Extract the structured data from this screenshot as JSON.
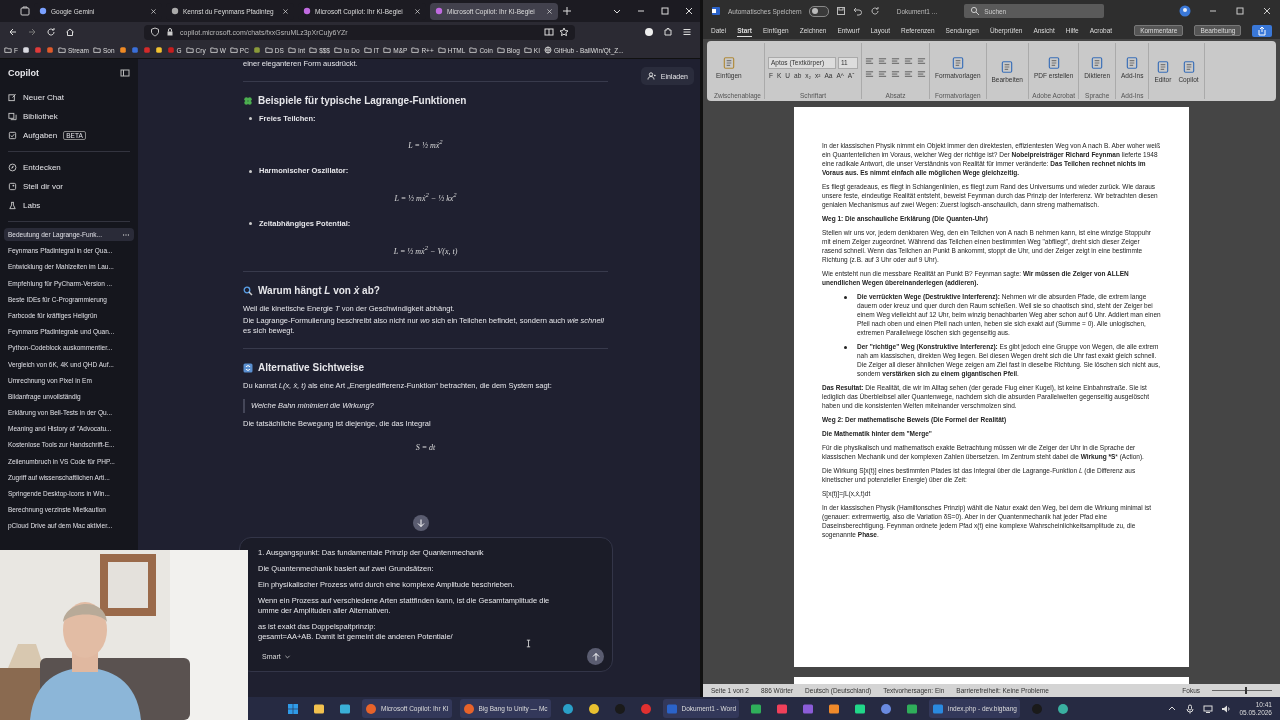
{
  "browser": {
    "tabs": [
      {
        "label": "Google Gemini",
        "selected": false
      },
      {
        "label": "Kennst du Feynmans Pfadinteg",
        "selected": false
      },
      {
        "label": "Microsoft Copilot: Ihr KI-Beglei",
        "selected": false
      },
      {
        "label": "Microsoft Copilot: Ihr KI-Beglei",
        "selected": true
      }
    ],
    "url": "copilot.microsoft.com/chats/fxxGsruMLz3pXrCujy6YZr",
    "bookmarks": [
      {
        "kind": "folder",
        "label": "F"
      },
      {
        "kind": "site",
        "color": "#d9d9e0"
      },
      {
        "kind": "site",
        "color": "#e03a3a"
      },
      {
        "kind": "site",
        "color": "#e05a2a"
      },
      {
        "kind": "folder",
        "label": "Stream"
      },
      {
        "kind": "folder",
        "label": "Son"
      },
      {
        "kind": "site",
        "color": "#f08a24"
      },
      {
        "kind": "site",
        "color": "#3a6fd8"
      },
      {
        "kind": "site",
        "color": "#d42a2a"
      },
      {
        "kind": "site",
        "color": "#f2c230"
      },
      {
        "kind": "site",
        "color": "#c81e1e",
        "label": "G"
      },
      {
        "kind": "folder",
        "label": "Cry"
      },
      {
        "kind": "folder",
        "label": "W"
      },
      {
        "kind": "folder",
        "label": "PC"
      },
      {
        "kind": "site",
        "color": "#8a9a3a"
      },
      {
        "kind": "folder",
        "label": "DS"
      },
      {
        "kind": "folder",
        "label": "Int"
      },
      {
        "kind": "folder",
        "label": "$$$"
      },
      {
        "kind": "folder",
        "label": "to Do"
      },
      {
        "kind": "folder",
        "label": "IT"
      },
      {
        "kind": "folder",
        "label": "M&P"
      },
      {
        "kind": "folder",
        "label": "R++"
      },
      {
        "kind": "folder",
        "label": "HTML"
      },
      {
        "kind": "folder",
        "label": "Coin"
      },
      {
        "kind": "folder",
        "label": "Blog"
      },
      {
        "kind": "folder",
        "label": "KI"
      },
      {
        "kind": "globe",
        "label": "GitHub - BallWin/Qt_Z..."
      }
    ]
  },
  "copilot": {
    "title": "Copilot",
    "nav": [
      {
        "kind": "new",
        "label": "Neuer Chat"
      },
      {
        "kind": "library",
        "label": "Bibliothek"
      },
      {
        "kind": "tasks",
        "label": "Aufgaben",
        "badge": "BETA"
      },
      {
        "kind": "discover",
        "label": "Entdecken"
      },
      {
        "kind": "imagine",
        "label": "Stell dir vor"
      },
      {
        "kind": "labs",
        "label": "Labs"
      }
    ],
    "conversations": [
      {
        "label": "Bedeutung der Lagrange-Funk...",
        "selected": true
      },
      {
        "label": "Feynmans Pfadintegral in der Qua...",
        "selected": false
      },
      {
        "label": "Entwicklung der Mahlzeiten im Lau...",
        "selected": false
      },
      {
        "label": "Empfehlung für PyCharm-Version ...",
        "selected": false
      },
      {
        "label": "Beste IDEs für C-Programmierung",
        "selected": false
      },
      {
        "label": "Farbcode für kräftiges Hellgrün",
        "selected": false
      },
      {
        "label": "Feynmans Pfadintegrale und Quan...",
        "selected": false
      },
      {
        "label": "Python-Codeblock auskommentier...",
        "selected": false
      },
      {
        "label": "Vergleich von 6K, 4K und QHD Auf...",
        "selected": false
      },
      {
        "label": "Umrechnung von Pixel in Em",
        "selected": false
      },
      {
        "label": "Bildanfrage unvollständig",
        "selected": false
      },
      {
        "label": "Erklärung von Bell-Tests in der Qu...",
        "selected": false
      },
      {
        "label": "Meaning and History of \"Advocatu...",
        "selected": false
      },
      {
        "label": "Kostenlose Tools zur Handschrift-E...",
        "selected": false
      },
      {
        "label": "Zeilenumbruch in VS Code für PHP...",
        "selected": false
      },
      {
        "label": "Zugriff auf wissenschaftlichen Arti...",
        "selected": false
      },
      {
        "label": "Springende Desktop-Icons in Win...",
        "selected": false
      },
      {
        "label": "Berechnung verzinste Mietkaution",
        "selected": false
      },
      {
        "label": "pCloud Drive auf dem Mac aktivier...",
        "selected": false
      }
    ],
    "invite": "Einladen",
    "messages": [
      {
        "kind": "para",
        "text": "einer eleganteren Form ausdrückt."
      },
      {
        "kind": "rule"
      },
      {
        "kind": "heading",
        "text": "Beispiele für typische Lagrange-Funktionen"
      },
      {
        "kind": "bullet",
        "text": "Freies Teilchen:"
      },
      {
        "kind": "formula",
        "text": "L = ½ mẋ$^{2}$"
      },
      {
        "kind": "bullet",
        "text": "Harmonischer Oszillator:"
      },
      {
        "kind": "formula",
        "text": "L = ½ mẋ$^{2}$ − ½ kx$^{2}$"
      },
      {
        "kind": "bullet",
        "text": "Zeitabhängiges Potential:"
      },
      {
        "kind": "formula",
        "text": "L = ½ mẋ$^{2}$ − V(x, t)"
      },
      {
        "kind": "rule"
      },
      {
        "kind": "heading",
        "text": "Warum hängt *L* von *ẋ* ab?"
      },
      {
        "kind": "para",
        "text": "Weil die kinetische Energie *T* von der Geschwindigkeit abhängt."
      },
      {
        "kind": "para",
        "text": "Die Lagrange-Formulierung beschreibt also nicht nur *wo* sich ein Teilchen befindet, sondern auch *wie schnell* es sich bewegt."
      },
      {
        "kind": "rule"
      },
      {
        "kind": "heading",
        "text": "Alternative Sichtweise"
      },
      {
        "kind": "para",
        "text": "Du kannst *L(x, ẋ, t)* als eine Art „Energiedifferenz-Funktion“ betrachten, die dem System sagt:"
      },
      {
        "kind": "quote",
        "text": "Welche Bahn minimiert die Wirkung?"
      },
      {
        "kind": "para",
        "text": "Die tatsächliche Bewegung ist diejenige, die das Integral"
      },
      {
        "kind": "formula",
        "text": "S =       dt"
      }
    ],
    "composer": {
      "paragraphs": [
        [
          "1. Ausgangspunkt: Das fundamentale Prinzip der Quantenmechanik"
        ],
        [
          "Die Quantenmechanik basiert auf zwei Grundsätzen:"
        ],
        [
          "Ein physikalischer Prozess wird durch eine komplexe Amplitude beschrieben."
        ],
        [
          "Wenn ein Prozess auf verschiedene Arten stattfinden kann, ist die Gesamtamplitude die",
          "umme der Amplituden aller Alternativen."
        ],
        [
          "as ist exakt das Doppelspaltprinzip:",
          "gesamt=AA+AB. Damit ist gemeint die anderen Potentiale/"
        ]
      ],
      "mode": "Smart"
    }
  },
  "word": {
    "autosave_label": "Automatisches Speichern",
    "autosave_on": false,
    "doc_title": "Dokument1 ...",
    "search": {
      "placeholder": "Suchen"
    },
    "menu": [
      {
        "label": "Datei",
        "selected": false
      },
      {
        "label": "Start",
        "selected": true
      },
      {
        "label": "Einfügen",
        "selected": false
      },
      {
        "label": "Zeichnen",
        "selected": false
      },
      {
        "label": "Entwurf",
        "selected": false
      },
      {
        "label": "Layout",
        "selected": false
      },
      {
        "label": "Referenzen",
        "selected": false
      },
      {
        "label": "Sendungen",
        "selected": false
      },
      {
        "label": "Überprüfen",
        "selected": false
      },
      {
        "label": "Ansicht",
        "selected": false
      },
      {
        "label": "Hilfe",
        "selected": false
      },
      {
        "label": "Acrobat",
        "selected": false
      }
    ],
    "comments": "Kommentare",
    "editing": "Bearbeitung",
    "ribbon": [
      {
        "kind": "clipboard",
        "label": "Zwischenablage",
        "buttons": [
          "Einfügen"
        ]
      },
      {
        "kind": "font",
        "label": "Schriftart",
        "font": "Aptos (Textkörper)",
        "size": "11",
        "tools": [
          "F",
          "K",
          "U",
          "ab",
          "x₂",
          "x²",
          "Aa",
          "A^",
          "Aˇ"
        ]
      },
      {
        "kind": "paragraph",
        "label": "Absatz"
      },
      {
        "kind": "buttons",
        "label": "Formatvorlagen",
        "buttons": [
          "Formatvorlagen"
        ]
      },
      {
        "kind": "buttons",
        "buttons": [
          "Bearbeiten"
        ]
      },
      {
        "kind": "buttons",
        "label": "Adobe Acrobat",
        "buttons": [
          "PDF erstellen"
        ]
      },
      {
        "kind": "buttons",
        "label": "Sprache",
        "buttons": [
          "Diktieren"
        ]
      },
      {
        "kind": "buttons",
        "label": "Add-Ins",
        "buttons": [
          "Add-Ins"
        ]
      },
      {
        "kind": "buttons",
        "buttons": [
          "Editor",
          "Copilot"
        ]
      }
    ],
    "document": [
      {
        "kind": "para",
        "text": "In der klassischen Physik nimmt ein Objekt immer den direktesten, effizientesten Weg von A nach B. Aber woher weiß ein Quantenteilchen im Voraus, welcher Weg der richtige ist? Der **Nobelpreisträger Richard Feynman** lieferte 1948 eine radikale Antwort, die unser Verständnis von Realität für immer veränderte: **Das Teilchen rechnet nichts im Voraus aus. Es nimmt einfach alle möglichen Wege gleichzeitig.**"
      },
      {
        "kind": "para",
        "text": "Es fliegt geradeaus, es fliegt in Schlangenlinien, es fliegt zum Rand des Universums und wieder zurück. Wie daraus unsere feste, eindeutige Realität entsteht, beweist Feynman durch das Prinzip der Interferenz. Wir betrachten diesen genialen Mechanismus auf zwei Wegen: Zuerst logisch-anschaulich, dann streng mathematisch."
      },
      {
        "kind": "heading",
        "text": "Weg 1: Die anschauliche Erklärung (Die Quanten-Uhr)"
      },
      {
        "kind": "para",
        "text": "Stellen wir uns vor, jedem denkbaren Weg, den ein Teilchen von A nach B nehmen kann, ist eine winzige Stoppuhr mit einem Zeiger zugeordnet. Während das Teilchen einen bestimmten Weg \"abfliegt\", dreht sich dieser Zeiger rasend schnell. Wenn das Teilchen an Punkt B ankommt, stoppt die Uhr, und der Zeiger zeigt in eine bestimmte Richtung (z.B. auf 3 Uhr oder auf 9 Uhr)."
      },
      {
        "kind": "para",
        "text": "Wie entsteht nun die messbare Realität an Punkt B? Feynman sagte: **Wir müssen die Zeiger von ALLEN unendlichen Wegen übereinanderlegen (addieren).**"
      },
      {
        "kind": "bullet",
        "text": "**Die verrückten Wege (Destruktive Interferenz):** Nehmen wir die absurden Pfade, die extrem lange dauern oder kreuz und quer durch den Raum schießen. Weil sie so chaotisch sind, steht der Zeiger bei einem Weg vielleicht auf 12 Uhr, beim winzig benachbarten Weg aber schon auf 6 Uhr. Addiert man einen Pfeil nach oben und einen Pfeil nach unten, heben sie sich exakt auf (Summe = 0). Alle unlogischen, extremen Parallelwege löschen sich gegenseitig aus."
      },
      {
        "kind": "bullet",
        "text": "**Der \"richtige\" Weg (Konstruktive Interferenz):** Es gibt jedoch eine Gruppe von Wegen, die alle extrem nah am klassischen, direkten Weg liegen. Bei diesen Wegen dreht sich die Uhr fast exakt gleich schnell. Die Zeiger all dieser ähnlichen Wege zeigen am Ziel fast in dieselbe Richtung. Sie löschen sich nicht aus, sondern **verstärken sich zu einem gigantischen Pfeil**."
      },
      {
        "kind": "para",
        "text": "**Das Resultat:** Die Realität, die wir im Alltag sehen (der gerade Flug einer Kugel), ist keine Einbahnstraße. Sie ist lediglich das Überbleibsel aller Quantenwege, nachdem sich die absurden Parallelwelten gegenseitig ausgelöscht haben und die konsistenten Welten miteinander verschmolzen sind."
      },
      {
        "kind": "heading",
        "text": "Weg 2: Der mathematische Beweis (Die Formel der Realität)"
      },
      {
        "kind": "heading",
        "text": "Die Mathematik hinter dem \"Merge\""
      },
      {
        "kind": "para",
        "text": "Für die physikalisch und mathematisch exakte Betrachtung müssen wir die Zeiger der Uhr in die Sprache der klassischen Mechanik und der komplexen Zahlen übersetzen. Im Zentrum steht dabei die **Wirkung *S*** (Action)."
      },
      {
        "kind": "para",
        "text": "Die Wirkung S[x(t)] eines bestimmten Pfades ist das Integral über die Lagrange-Funktion *L* (die Differenz aus kinetischer und potenzieller Energie) über die Zeit:"
      },
      {
        "kind": "para",
        "text": "S[x(t)]=∫L(x,ẋ,t)dt"
      },
      {
        "kind": "para",
        "text": "In der klassischen Physik (Hamiltonsches Prinzip) wählt die Natur exakt den Weg, bei dem die Wirkung minimal ist (genauer: extremwertig, also die Variation δS=0). Aber in der Quantenmechanik hat jeder Pfad eine Daseinsberechtigung. Feynman ordnete jedem Pfad x(t) eine komplexe Wahrscheinlichkeitsamplitude zu, die sogenannte **Phase**."
      }
    ],
    "status": [
      "Seite 1 von 2",
      "886 Wörter",
      "Deutsch (Deutschland)",
      "Textvorhersagen: Ein",
      "Barrierefreiheit: Keine Probleme"
    ],
    "focus": "Fokus",
    "zoom": {
      "level": 0.55
    }
  },
  "taskbar": {
    "apps": [
      {
        "kind": "windows"
      },
      {
        "kind": "folder"
      },
      {
        "kind": "monitor"
      },
      {
        "kind": "firefox",
        "label": "Microsoft Copilot: Ihr KI",
        "active": true
      },
      {
        "kind": "firefox",
        "label": "Big Bang to Unity — Mc",
        "active": true
      },
      {
        "kind": "edge"
      },
      {
        "kind": "chrome"
      },
      {
        "kind": "dark"
      },
      {
        "kind": "red"
      },
      {
        "kind": "word",
        "label": "Dokument1 - Word",
        "active": true
      },
      {
        "kind": "green"
      },
      {
        "kind": "music"
      },
      {
        "kind": "purple"
      },
      {
        "kind": "orange"
      },
      {
        "kind": "pycharm"
      },
      {
        "kind": "bluecircle"
      },
      {
        "kind": "green"
      },
      {
        "kind": "vscode",
        "label": "index.php - dev.bigbang",
        "active": true
      },
      {
        "kind": "dark"
      },
      {
        "kind": "globe"
      }
    ],
    "time": "10:41",
    "date": "05.05.2026"
  }
}
